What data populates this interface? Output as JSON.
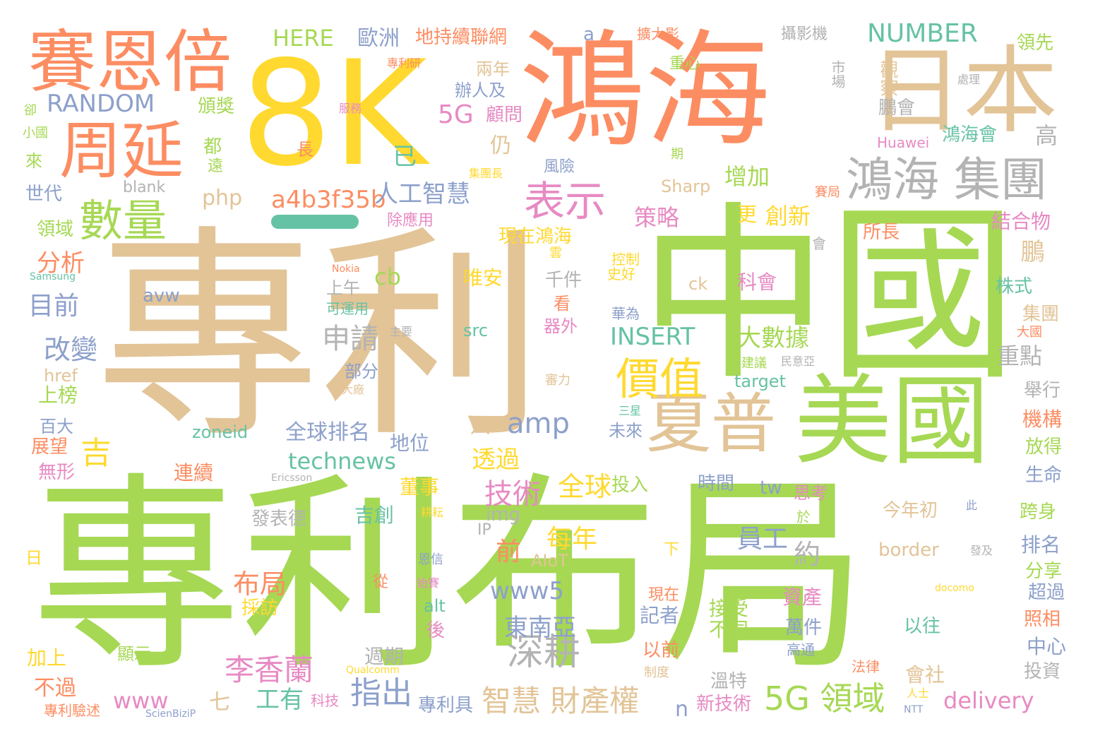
{
  "wordcloud": {
    "palette": {
      "tan": "#e2c497",
      "green": "#a6d854",
      "orange": "#fc8d62",
      "yellow": "#ffd92f",
      "teal": "#66c2a5",
      "blue": "#8da0cb",
      "pink": "#e78ac3",
      "gray": "#b3b3b3"
    },
    "words": [
      {
        "text": "專利",
        "color": "#e2c497"
      },
      {
        "text": "專利布局",
        "color": "#a6d854"
      },
      {
        "text": "中國",
        "color": "#a6d854"
      },
      {
        "text": "8K",
        "color": "#ffd92f"
      },
      {
        "text": "鴻海",
        "color": "#fc8d62"
      },
      {
        "text": "美國",
        "color": "#a6d854"
      },
      {
        "text": "日本",
        "color": "#e2c497"
      },
      {
        "text": "賽恩倍",
        "color": "#fc8d62"
      },
      {
        "text": "周延",
        "color": "#fc8d62"
      },
      {
        "text": "夏普",
        "color": "#e2c497"
      },
      {
        "text": "鴻海 集團",
        "color": "#b3b3b3"
      },
      {
        "text": "數量",
        "color": "#a6d854"
      },
      {
        "text": "表示",
        "color": "#e78ac3"
      },
      {
        "text": "價值",
        "color": "#ffd92f"
      },
      {
        "text": "深耕",
        "color": "#b3b3b3"
      },
      {
        "text": "5G 領域",
        "color": "#a6d854"
      },
      {
        "text": "智慧 財產權",
        "color": "#e2c497"
      },
      {
        "text": "李香蘭",
        "color": "#e78ac3"
      },
      {
        "text": "技術",
        "color": "#e78ac3"
      },
      {
        "text": "布局",
        "color": "#fc8d62"
      },
      {
        "text": "指出",
        "color": "#8da0cb"
      },
      {
        "text": "吉",
        "color": "#ffd92f"
      },
      {
        "text": "amp",
        "color": "#8da0cb"
      },
      {
        "text": "a4b3f35b",
        "color": "#fc8d62"
      },
      {
        "text": "人工智慧",
        "color": "#8da0cb"
      },
      {
        "text": "NUMBER",
        "color": "#66c2a5"
      },
      {
        "text": "RANDOM",
        "color": "#8da0cb"
      },
      {
        "text": "HERE",
        "color": "#a6d854"
      },
      {
        "text": "歐洲",
        "color": "#8da0cb"
      },
      {
        "text": "地持續聯網",
        "color": "#fc8d62"
      },
      {
        "text": "a",
        "color": "#8da0cb"
      },
      {
        "text": "擴大影",
        "color": "#fc8d62"
      },
      {
        "text": "攝影機",
        "color": "#b3b3b3"
      },
      {
        "text": "領先",
        "color": "#a6d854"
      },
      {
        "text": "專利研",
        "color": "#fc8d62"
      },
      {
        "text": "重心",
        "color": "#a6d854"
      },
      {
        "text": "市場",
        "color": "#b3b3b3"
      },
      {
        "text": "處理",
        "color": "#b3b3b3"
      },
      {
        "text": "觀察",
        "color": "#e2c497"
      },
      {
        "text": "鵬會",
        "color": "#b3b3b3"
      },
      {
        "text": "兩年",
        "color": "#e2c497"
      },
      {
        "text": "辦人及",
        "color": "#8da0cb"
      },
      {
        "text": "5G",
        "color": "#e78ac3"
      },
      {
        "text": "顧問",
        "color": "#e78ac3"
      },
      {
        "text": "仍",
        "color": "#e2c497"
      },
      {
        "text": "已",
        "color": "#66c2a5"
      },
      {
        "text": "頒獎",
        "color": "#a6d854"
      },
      {
        "text": "服務",
        "color": "#e78ac3"
      },
      {
        "text": "卻",
        "color": "#a6d854"
      },
      {
        "text": "小國",
        "color": "#a6d854"
      },
      {
        "text": "來",
        "color": "#a6d854"
      },
      {
        "text": "都",
        "color": "#a6d854"
      },
      {
        "text": "遠",
        "color": "#a6d854"
      },
      {
        "text": "長",
        "color": "#fc8d62"
      },
      {
        "text": "世代",
        "color": "#8da0cb"
      },
      {
        "text": "blank",
        "color": "#b3b3b3"
      },
      {
        "text": "php",
        "color": "#e2c497"
      },
      {
        "text": "集團長",
        "color": "#ffd92f"
      },
      {
        "text": "風險",
        "color": "#8da0cb"
      },
      {
        "text": "期",
        "color": "#a6d854"
      },
      {
        "text": "Sharp",
        "color": "#e2c497"
      },
      {
        "text": "增加",
        "color": "#a6d854"
      },
      {
        "text": "賽局",
        "color": "#fc8d62"
      },
      {
        "text": "Huawei",
        "color": "#e78ac3"
      },
      {
        "text": "鴻海會",
        "color": "#66c2a5"
      },
      {
        "text": "高",
        "color": "#b3b3b3"
      },
      {
        "text": "領域",
        "color": "#a6d854"
      },
      {
        "text": "除應用",
        "color": "#e78ac3"
      },
      {
        "text": "策略",
        "color": "#e78ac3"
      },
      {
        "text": "更",
        "color": "#ffd92f"
      },
      {
        "text": "創新",
        "color": "#ffd92f"
      },
      {
        "text": "現在鴻海",
        "color": "#ffd92f"
      },
      {
        "text": "雲",
        "color": "#ffd92f"
      },
      {
        "text": "所長",
        "color": "#fc8d62"
      },
      {
        "text": "會",
        "color": "#b3b3b3"
      },
      {
        "text": "鵬",
        "color": "#e2c497"
      },
      {
        "text": "結合物",
        "color": "#e78ac3"
      },
      {
        "text": "分析",
        "color": "#fc8d62"
      },
      {
        "text": "Samsung",
        "color": "#66c2a5"
      },
      {
        "text": "Nokia",
        "color": "#fc8d62"
      },
      {
        "text": "目前",
        "color": "#8da0cb"
      },
      {
        "text": "cb",
        "color": "#a6d854"
      },
      {
        "text": "唯安",
        "color": "#ffd92f"
      },
      {
        "text": "上午",
        "color": "#b3b3b3"
      },
      {
        "text": "千件",
        "color": "#b3b3b3"
      },
      {
        "text": "控制",
        "color": "#ffd92f"
      },
      {
        "text": "史好",
        "color": "#ffd92f"
      },
      {
        "text": "ck",
        "color": "#e2c497"
      },
      {
        "text": "科會",
        "color": "#e78ac3"
      },
      {
        "text": "株式",
        "color": "#66c2a5"
      },
      {
        "text": "avw",
        "color": "#8da0cb"
      },
      {
        "text": "可運用",
        "color": "#66c2a5"
      },
      {
        "text": "看",
        "color": "#fc8d62"
      },
      {
        "text": "器外",
        "color": "#e78ac3"
      },
      {
        "text": "華為",
        "color": "#8da0cb"
      },
      {
        "text": "集團",
        "color": "#e2c497"
      },
      {
        "text": "大國",
        "color": "#fc8d62"
      },
      {
        "text": "改變",
        "color": "#8da0cb"
      },
      {
        "text": "申請",
        "color": "#b3b3b3"
      },
      {
        "text": "主要",
        "color": "#b3b3b3"
      },
      {
        "text": "src",
        "color": "#66c2a5"
      },
      {
        "text": "INSERT",
        "color": "#66c2a5"
      },
      {
        "text": "大數據",
        "color": "#a6d854"
      },
      {
        "text": "重點",
        "color": "#b3b3b3"
      },
      {
        "text": "href",
        "color": "#e2c497"
      },
      {
        "text": "部分",
        "color": "#8da0cb"
      },
      {
        "text": "建議",
        "color": "#a6d854"
      },
      {
        "text": "民意亞",
        "color": "#b3b3b3"
      },
      {
        "text": "上榜",
        "color": "#a6d854"
      },
      {
        "text": "大廠",
        "color": "#e2c497"
      },
      {
        "text": "審力",
        "color": "#e2c497"
      },
      {
        "text": "target",
        "color": "#66c2a5"
      },
      {
        "text": "舉行",
        "color": "#b3b3b3"
      },
      {
        "text": "百大",
        "color": "#8da0cb"
      },
      {
        "text": "八",
        "color": "#e2c497"
      },
      {
        "text": "三星",
        "color": "#66c2a5"
      },
      {
        "text": "機構",
        "color": "#fc8d62"
      },
      {
        "text": "展望",
        "color": "#fc8d62"
      },
      {
        "text": "zoneid",
        "color": "#66c2a5"
      },
      {
        "text": "全球排名",
        "color": "#8da0cb"
      },
      {
        "text": "地位",
        "color": "#8da0cb"
      },
      {
        "text": "未來",
        "color": "#8da0cb"
      },
      {
        "text": "放得",
        "color": "#a6d854"
      },
      {
        "text": "無形",
        "color": "#e78ac3"
      },
      {
        "text": "technews",
        "color": "#66c2a5"
      },
      {
        "text": "透過",
        "color": "#ffd92f"
      },
      {
        "text": "連續",
        "color": "#fc8d62"
      },
      {
        "text": "生命",
        "color": "#8da0cb"
      },
      {
        "text": "Ericsson",
        "color": "#b3b3b3"
      },
      {
        "text": "全球",
        "color": "#ffd92f"
      },
      {
        "text": "投入",
        "color": "#a6d854"
      },
      {
        "text": "時間",
        "color": "#8da0cb"
      },
      {
        "text": "tw",
        "color": "#8da0cb"
      },
      {
        "text": "思考",
        "color": "#e78ac3"
      },
      {
        "text": "董事",
        "color": "#ffd92f"
      },
      {
        "text": "img",
        "color": "#b3b3b3"
      },
      {
        "text": "IP",
        "color": "#b3b3b3"
      },
      {
        "text": "耕耘",
        "color": "#ffd92f"
      },
      {
        "text": "吉創",
        "color": "#66c2a5"
      },
      {
        "text": "發表德",
        "color": "#b3b3b3"
      },
      {
        "text": "今年初",
        "color": "#e2c497"
      },
      {
        "text": "於",
        "color": "#a6d854"
      },
      {
        "text": "此",
        "color": "#8da0cb"
      },
      {
        "text": "跨身",
        "color": "#a6d854"
      },
      {
        "text": "每年",
        "color": "#ffd92f"
      },
      {
        "text": "前",
        "color": "#fc8d62"
      },
      {
        "text": "AIoT",
        "color": "#e2c497"
      },
      {
        "text": "員工",
        "color": "#8da0cb"
      },
      {
        "text": "約",
        "color": "#b3b3b3"
      },
      {
        "text": "border",
        "color": "#e2c497"
      },
      {
        "text": "日",
        "color": "#ffd92f"
      },
      {
        "text": "恩信",
        "color": "#8da0cb"
      },
      {
        "text": "下",
        "color": "#ffd92f"
      },
      {
        "text": "發及",
        "color": "#b3b3b3"
      },
      {
        "text": "排名",
        "color": "#8da0cb"
      },
      {
        "text": "分享",
        "color": "#a6d854"
      },
      {
        "text": "從",
        "color": "#fc8d62"
      },
      {
        "text": "www5",
        "color": "#8da0cb"
      },
      {
        "text": "始賽",
        "color": "#e78ac3"
      },
      {
        "text": "docomo",
        "color": "#ffd92f"
      },
      {
        "text": "超過",
        "color": "#8da0cb"
      },
      {
        "text": "採訪",
        "color": "#ffd92f"
      },
      {
        "text": "alt",
        "color": "#66c2a5"
      },
      {
        "text": "現在",
        "color": "#fc8d62"
      },
      {
        "text": "記者",
        "color": "#8da0cb"
      },
      {
        "text": "接受",
        "color": "#a6d854"
      },
      {
        "text": "不同",
        "color": "#a6d854"
      },
      {
        "text": "資產",
        "color": "#e78ac3"
      },
      {
        "text": "照相",
        "color": "#fc8d62"
      },
      {
        "text": "東南亞",
        "color": "#8da0cb"
      },
      {
        "text": "後",
        "color": "#e78ac3"
      },
      {
        "text": "萬件",
        "color": "#8da0cb"
      },
      {
        "text": "以往",
        "color": "#66c2a5"
      },
      {
        "text": "中心",
        "color": "#8da0cb"
      },
      {
        "text": "加上",
        "color": "#ffd92f"
      },
      {
        "text": "顯示",
        "color": "#a6d854"
      },
      {
        "text": "週期",
        "color": "#b3b3b3"
      },
      {
        "text": "以前",
        "color": "#fc8d62"
      },
      {
        "text": "高通",
        "color": "#8da0cb"
      },
      {
        "text": "制度",
        "color": "#e2c497"
      },
      {
        "text": "法律",
        "color": "#fc8d62"
      },
      {
        "text": "投資",
        "color": "#b3b3b3"
      },
      {
        "text": "Qualcomm",
        "color": "#ffd92f"
      },
      {
        "text": "會社",
        "color": "#e2c497"
      },
      {
        "text": "不過",
        "color": "#fc8d62"
      },
      {
        "text": "溫特",
        "color": "#b3b3b3"
      },
      {
        "text": "www",
        "color": "#e78ac3"
      },
      {
        "text": "七",
        "color": "#e2c497"
      },
      {
        "text": "工有",
        "color": "#66c2a5"
      },
      {
        "text": "科技",
        "color": "#e78ac3"
      },
      {
        "text": "專利具",
        "color": "#8da0cb"
      },
      {
        "text": "新技術",
        "color": "#e78ac3"
      },
      {
        "text": "人士",
        "color": "#ffd92f"
      },
      {
        "text": "delivery",
        "color": "#e78ac3"
      },
      {
        "text": "NTT",
        "color": "#8da0cb"
      },
      {
        "text": "專利驗述",
        "color": "#fc8d62"
      },
      {
        "text": "ScienBiziP",
        "color": "#8da0cb"
      },
      {
        "text": "n",
        "color": "#8da0cb"
      }
    ]
  }
}
